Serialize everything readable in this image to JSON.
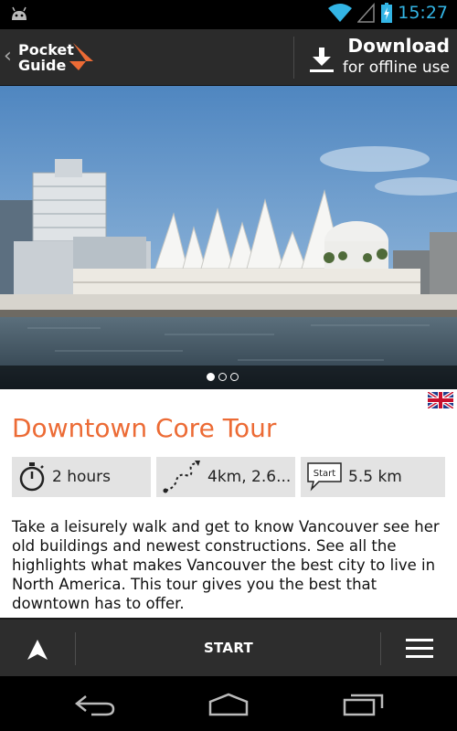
{
  "status_bar": {
    "time": "15:27"
  },
  "header": {
    "logo_line1": "Pocket",
    "logo_line2": "Guide",
    "download_title": "Download",
    "download_subtitle": "for offline use"
  },
  "carousel": {
    "total": 3,
    "active": 0
  },
  "tour": {
    "title": "Downtown Core Tour",
    "language_flag": "uk-flag-icon",
    "stats": {
      "duration": "2 hours",
      "route": "4km, 2.6...",
      "distance": "5.5 km"
    },
    "start_badge": "Start",
    "description": "Take a leisurely walk and get to know Vancouver see her old buildings and newest constructions. See all the highlights what makes Vancouver the best city to live in North America. This tour gives you the best that downtown has to offer."
  },
  "action_bar": {
    "start_label": "START"
  },
  "colors": {
    "accent": "#ec6b35",
    "status_blue": "#33b5e5",
    "bar_bg": "#2d2d2d"
  }
}
